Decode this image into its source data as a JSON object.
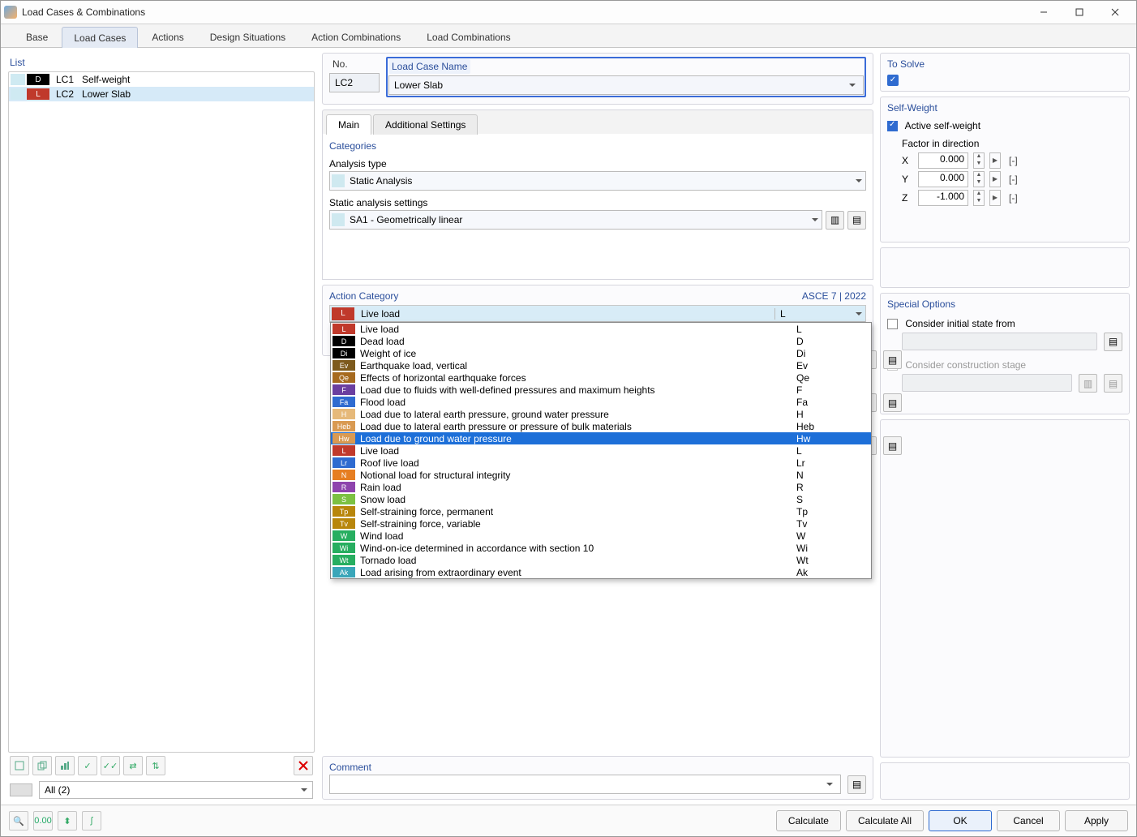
{
  "window": {
    "title": "Load Cases & Combinations"
  },
  "topTabs": [
    "Base",
    "Load Cases",
    "Actions",
    "Design Situations",
    "Action Combinations",
    "Load Combinations"
  ],
  "topTabActive": 1,
  "list": {
    "label": "List",
    "items": [
      {
        "id": "LC1",
        "name": "Self-weight",
        "badge": "D",
        "badgeClass": "lc-d"
      },
      {
        "id": "LC2",
        "name": "Lower Slab",
        "badge": "L",
        "badgeClass": "lc-l"
      }
    ],
    "selected": 1,
    "filter": "All (2)"
  },
  "header": {
    "noLabel": "No.",
    "noValue": "LC2",
    "nameLabel": "Load Case Name",
    "nameValue": "Lower Slab",
    "solveLabel": "To Solve"
  },
  "innerTabs": [
    "Main",
    "Additional Settings"
  ],
  "innerActive": 0,
  "categories": {
    "title": "Categories",
    "analysisTypeLabel": "Analysis type",
    "analysisTypeValue": "Static Analysis",
    "settingsLabel": "Static analysis settings",
    "settingsValue": "SA1 - Geometrically linear"
  },
  "actionCategory": {
    "title": "Action Category",
    "standard": "ASCE 7 | 2022",
    "selectedBadge": "L",
    "selectedName": "Live load",
    "selectedCode": "L",
    "highlight": 9,
    "options": [
      {
        "b": "L",
        "c": "#c0392b",
        "n": "Live load",
        "k": "L"
      },
      {
        "b": "D",
        "c": "#000000",
        "n": "Dead load",
        "k": "D"
      },
      {
        "b": "Di",
        "c": "#000000",
        "n": "Weight of ice",
        "k": "Di"
      },
      {
        "b": "Ev",
        "c": "#7d5a1c",
        "n": "Earthquake load, vertical",
        "k": "Ev"
      },
      {
        "b": "Qe",
        "c": "#a66a1f",
        "n": "Effects of horizontal earthquake forces",
        "k": "Qe"
      },
      {
        "b": "F",
        "c": "#6b3fa0",
        "n": "Load due to fluids with well-defined pressures and maximum heights",
        "k": "F"
      },
      {
        "b": "Fa",
        "c": "#2f6bd0",
        "n": "Flood load",
        "k": "Fa"
      },
      {
        "b": "H",
        "c": "#e6b97a",
        "n": "Load due to lateral earth pressure, ground water pressure",
        "k": "H"
      },
      {
        "b": "Heb",
        "c": "#d99a52",
        "n": "Load due to lateral earth pressure or pressure of bulk materials",
        "k": "Heb"
      },
      {
        "b": "Hw",
        "c": "#d99a52",
        "n": "Load due to ground water pressure",
        "k": "Hw"
      },
      {
        "b": "L",
        "c": "#c0392b",
        "n": "Live load",
        "k": "L"
      },
      {
        "b": "Lr",
        "c": "#2f6bd0",
        "n": "Roof live load",
        "k": "Lr"
      },
      {
        "b": "N",
        "c": "#e67e22",
        "n": "Notional load for structural integrity",
        "k": "N"
      },
      {
        "b": "R",
        "c": "#8e44ad",
        "n": "Rain load",
        "k": "R"
      },
      {
        "b": "S",
        "c": "#7cc142",
        "n": "Snow load",
        "k": "S"
      },
      {
        "b": "Tp",
        "c": "#b8860b",
        "n": "Self-straining force, permanent",
        "k": "Tp"
      },
      {
        "b": "Tv",
        "c": "#b8860b",
        "n": "Self-straining force, variable",
        "k": "Tv"
      },
      {
        "b": "W",
        "c": "#27ae60",
        "n": "Wind load",
        "k": "W"
      },
      {
        "b": "Wi",
        "c": "#27ae60",
        "n": "Wind-on-ice determined in accordance with section 10",
        "k": "Wi"
      },
      {
        "b": "Wt",
        "c": "#27ae60",
        "n": "Tornado load",
        "k": "Wt"
      },
      {
        "b": "Ak",
        "c": "#3aa6b9",
        "n": "Load arising from extraordinary event",
        "k": "Ak"
      }
    ]
  },
  "selfWeight": {
    "title": "Self-Weight",
    "activeLabel": "Active self-weight",
    "factorLabel": "Factor in direction",
    "axes": [
      {
        "a": "X",
        "v": "0.000"
      },
      {
        "a": "Y",
        "v": "0.000"
      },
      {
        "a": "Z",
        "v": "-1.000"
      }
    ],
    "unit": "[-]"
  },
  "specialOptions": {
    "title": "Special Options",
    "initialState": "Consider initial state from",
    "construction": "Consider construction stage"
  },
  "comment": {
    "title": "Comment"
  },
  "footer": {
    "calculate": "Calculate",
    "calculateAll": "Calculate All",
    "ok": "OK",
    "cancel": "Cancel",
    "apply": "Apply"
  }
}
